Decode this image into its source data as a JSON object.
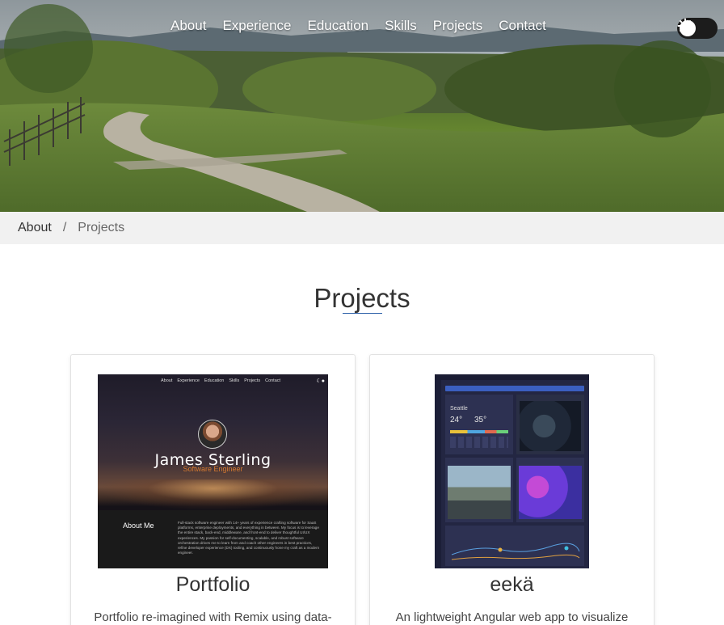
{
  "nav": {
    "links": [
      "About",
      "Experience",
      "Education",
      "Skills",
      "Projects",
      "Contact"
    ]
  },
  "theme_toggle": {
    "icon": "sun-icon"
  },
  "breadcrumb": {
    "home": "About",
    "separator": "/",
    "current": "Projects"
  },
  "section": {
    "title": "Projects"
  },
  "projects": [
    {
      "title": "Portfolio",
      "description": "Portfolio re-imagined with Remix using data-",
      "thumbnail": {
        "nav": [
          "About",
          "Experience",
          "Education",
          "Skills",
          "Projects",
          "Contact"
        ],
        "name": "James Sterling",
        "role": "Software Engineer",
        "about_label": "About Me",
        "about_text": "Full-stack software engineer with 14+ years of experience crafting software for SaaS platforms, enterprise deployments, and everything in between. My focus is to leverage the entire stack, back-end, middleware, and front-end to deliver thoughtful UI/UX experiences. My passion for self-documenting, scalable, and robust software orchestration drives me to learn from and coach other engineers in best practices, refine developer experience (DX) tooling, and continuously hone my craft as a modern engineer."
      }
    },
    {
      "title": "eekä",
      "description": "An lightweight Angular web app to visualize",
      "thumbnail": {
        "city": "Seattle",
        "temp_now": "24°",
        "temp_feels": "35°"
      }
    }
  ],
  "colors": {
    "accent_underline": "#2b5fa8",
    "breadcrumb_bg": "#f1f1f1",
    "role_orange": "#d77a2f"
  }
}
